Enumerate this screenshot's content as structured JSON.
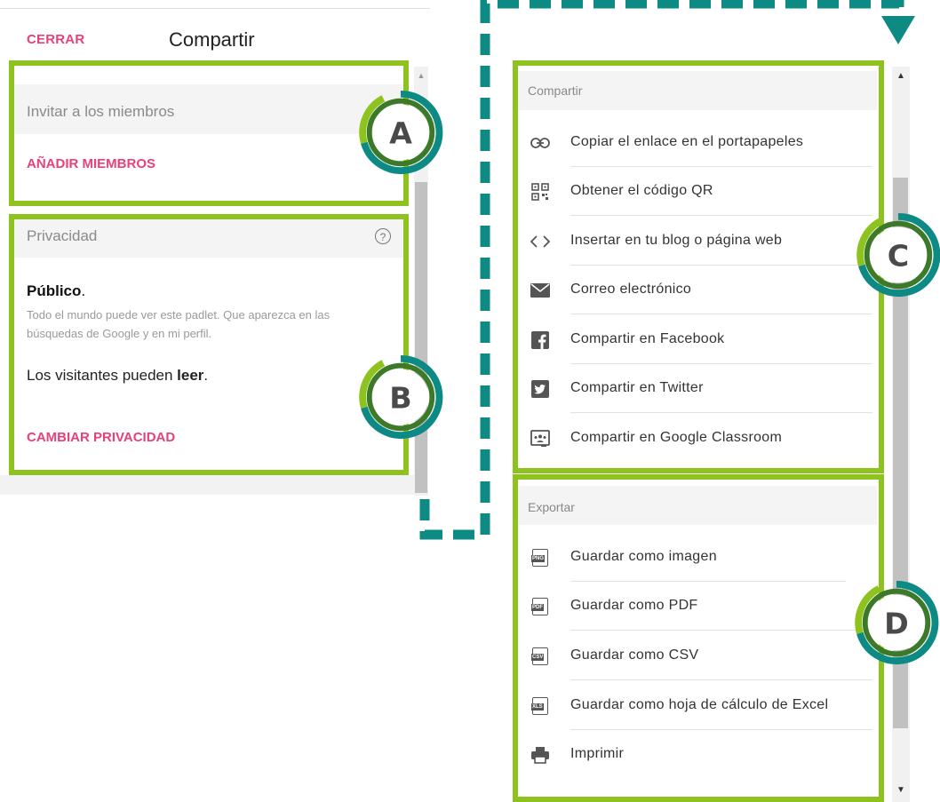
{
  "left_panel": {
    "close_label": "CERRAR",
    "title": "Compartir",
    "invite_placeholder": "Invitar a los miembros",
    "add_members_label": "AÑADIR MIEMBROS",
    "privacy_label": "Privacidad",
    "help_icon": "question-circle-icon",
    "public_title": "Público",
    "public_title_suffix": ".",
    "public_description": "Todo el mundo puede ver este padlet. Que aparezca en las búsquedas de Google y en mi perfil.",
    "visitors_prefix": "Los visitantes pueden ",
    "visitors_permission": "leer",
    "visitors_suffix": ".",
    "change_privacy_label": "CAMBIAR PRIVACIDAD"
  },
  "right_panel": {
    "share_section_title": "Compartir",
    "share_items": [
      {
        "label": "Copiar el enlace en el portapapeles",
        "icon": "link-icon"
      },
      {
        "label": "Obtener el código QR",
        "icon": "qr-code-icon"
      },
      {
        "label": "Insertar en tu blog o página web",
        "icon": "embed-code-icon"
      },
      {
        "label": "Correo electrónico",
        "icon": "email-icon"
      },
      {
        "label": "Compartir en Facebook",
        "icon": "facebook-icon"
      },
      {
        "label": "Compartir en Twitter",
        "icon": "twitter-icon"
      },
      {
        "label": "Compartir en Google Classroom",
        "icon": "google-classroom-icon"
      }
    ],
    "export_section_title": "Exportar",
    "export_items": [
      {
        "label": "Guardar como imagen",
        "icon": "png-file-icon",
        "badge": "PNG"
      },
      {
        "label": "Guardar como PDF",
        "icon": "pdf-file-icon",
        "badge": "PDF"
      },
      {
        "label": "Guardar como CSV",
        "icon": "csv-file-icon",
        "badge": "CSV"
      },
      {
        "label": "Guardar como hoja de cálculo de Excel",
        "icon": "xls-file-icon",
        "badge": "XLS"
      },
      {
        "label": "Imprimir",
        "icon": "printer-icon"
      }
    ]
  },
  "callouts": {
    "a": "A",
    "b": "B",
    "c": "C",
    "d": "D"
  },
  "colors": {
    "accent_pink": "#e8417a",
    "highlight_green": "#8dc21f",
    "arrow_teal": "#0e8a85",
    "badge_dark_green": "#3c7a2a"
  }
}
